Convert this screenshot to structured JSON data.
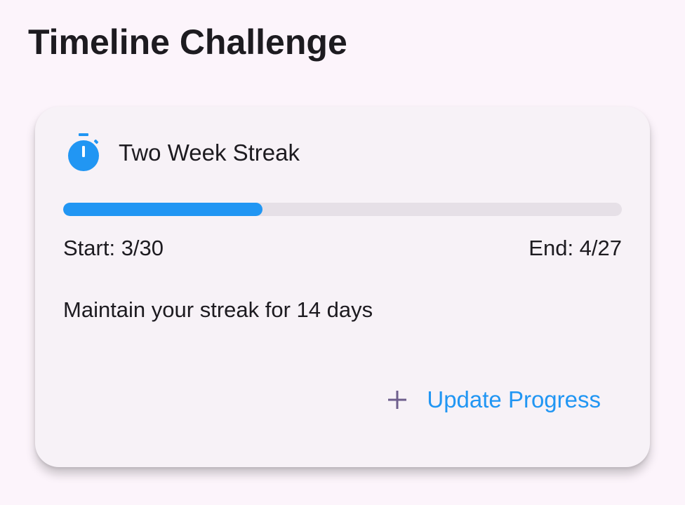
{
  "page": {
    "title": "Timeline Challenge"
  },
  "challenge": {
    "name": "Two Week Streak",
    "icon": "timer-icon",
    "progress_fraction": 0.357,
    "start_label": "Start: 3/30",
    "end_label": "End: 4/27",
    "description": "Maintain your streak for 14 days",
    "action": {
      "icon": "plus-icon",
      "label": "Update Progress"
    }
  },
  "colors": {
    "accent": "#2196f3",
    "background": "#fcf4fb",
    "card": "#f7f2f7",
    "track": "#e6e0e7",
    "plus_icon": "#6e5e8c"
  }
}
